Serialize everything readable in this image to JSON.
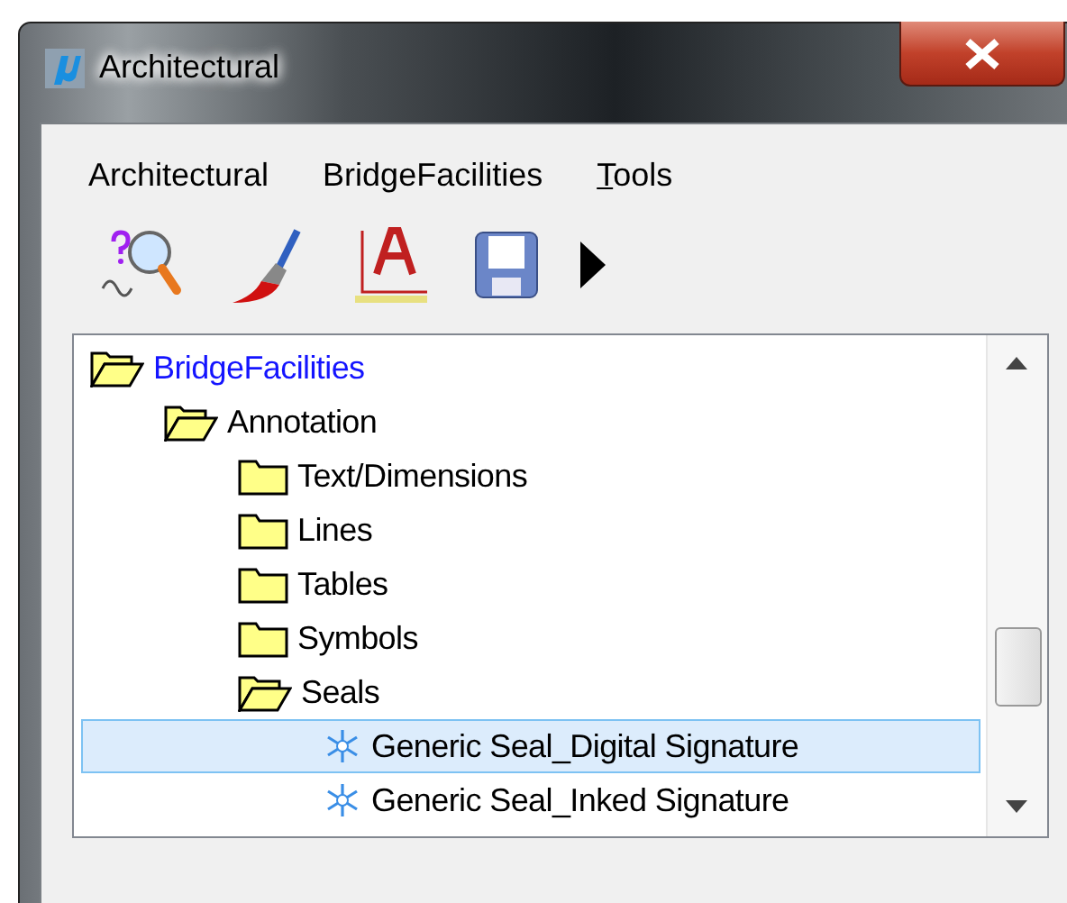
{
  "window": {
    "title": "Architectural"
  },
  "menu": [
    {
      "label": "Architectural",
      "mnemonic": false
    },
    {
      "label": "BridgeFacilities",
      "mnemonic": false
    },
    {
      "label": "Tools",
      "mnemonic": true
    }
  ],
  "toolbar": [
    {
      "kind": "query"
    },
    {
      "kind": "brush"
    },
    {
      "kind": "textstyle"
    },
    {
      "kind": "save"
    },
    {
      "kind": "more"
    }
  ],
  "tree": [
    {
      "label": "BridgeFacilities",
      "kind": "folder",
      "expanded": true,
      "active": true,
      "selected": false,
      "children": [
        {
          "label": "Annotation",
          "kind": "folder",
          "expanded": true,
          "active": false,
          "selected": false,
          "children": [
            {
              "label": "Text/Dimensions",
              "kind": "folder",
              "expanded": false,
              "active": false,
              "selected": false
            },
            {
              "label": "Lines",
              "kind": "folder",
              "expanded": false,
              "active": false,
              "selected": false
            },
            {
              "label": "Tables",
              "kind": "folder",
              "expanded": false,
              "active": false,
              "selected": false
            },
            {
              "label": "Symbols",
              "kind": "folder",
              "expanded": false,
              "active": false,
              "selected": false
            },
            {
              "label": "Seals",
              "kind": "folder",
              "expanded": true,
              "active": false,
              "selected": false,
              "children": [
                {
                  "label": "Generic Seal_Digital Signature",
                  "kind": "item",
                  "expanded": false,
                  "active": false,
                  "selected": true
                },
                {
                  "label": "Generic Seal_Inked Signature",
                  "kind": "item",
                  "expanded": false,
                  "active": false,
                  "selected": false
                }
              ]
            }
          ]
        }
      ]
    }
  ]
}
